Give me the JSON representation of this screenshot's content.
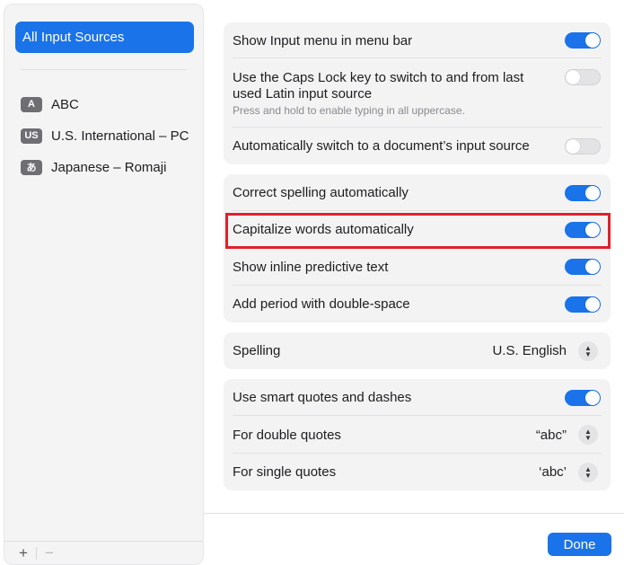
{
  "sidebar": {
    "selected_label": "All Input Sources",
    "sources": [
      {
        "badge": "A",
        "label": "ABC"
      },
      {
        "badge": "US",
        "label": "U.S. International – PC"
      },
      {
        "badge": "あ",
        "label": "Japanese – Romaji"
      }
    ],
    "add_label": "+",
    "remove_label": "−"
  },
  "input_group": {
    "show_menu_label": "Show Input menu in menu bar",
    "show_menu_on": true,
    "caps_lock_label_line1": "Use the Caps Lock key to switch to and from last",
    "caps_lock_label_line2": "used Latin input source",
    "caps_lock_hint": "Press and hold to enable typing in all uppercase.",
    "caps_lock_on": false,
    "auto_switch_label": "Automatically switch to a document’s input source",
    "auto_switch_on": false
  },
  "text_group": {
    "correct_spelling_label": "Correct spelling automatically",
    "correct_spelling_on": true,
    "capitalize_label": "Capitalize words automatically",
    "capitalize_on": true,
    "predictive_label": "Show inline predictive text",
    "predictive_on": true,
    "period_label": "Add period with double-space",
    "period_on": true
  },
  "spelling": {
    "label": "Spelling",
    "value": "U.S. English"
  },
  "quotes_group": {
    "smart_quotes_label": "Use smart quotes and dashes",
    "smart_quotes_on": true,
    "double_label": "For double quotes",
    "double_value": "“abc”",
    "single_label": "For single quotes",
    "single_value": "‘abc’"
  },
  "footer": {
    "done_label": "Done"
  },
  "colors": {
    "accent": "#1a73e8",
    "highlight": "#e0202c"
  }
}
